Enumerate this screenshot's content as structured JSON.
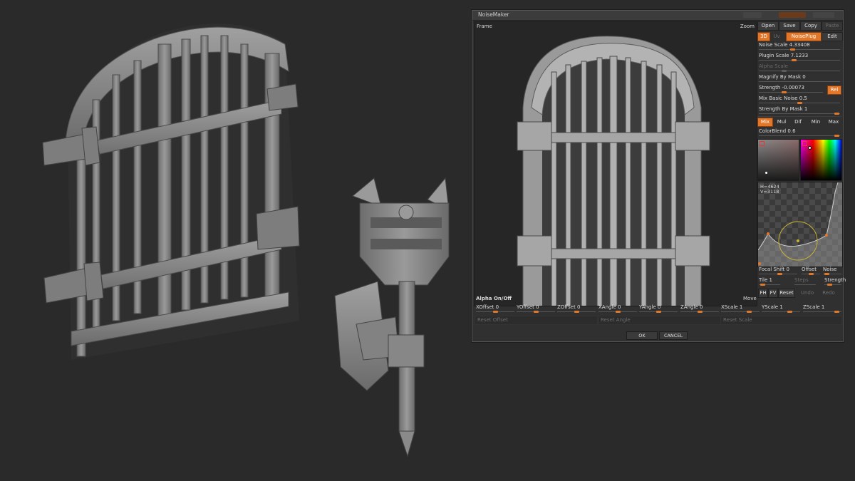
{
  "dialog": {
    "title": "NoiseMaker",
    "frame_label": "Frame",
    "zoom_label": "Zoom",
    "move_label": "Move",
    "alpha_toggle_label": "Alpha On/Off"
  },
  "file_buttons": {
    "open": "Open",
    "save": "Save",
    "copy": "Copy",
    "paste": "Paste"
  },
  "mode_buttons": {
    "three_d": "3D",
    "uv": "Uv",
    "noiseplug": "NoisePlug",
    "edit": "Edit"
  },
  "settings": {
    "noise_scale": "Noise Scale 4.33408",
    "plugin_scale": "Plugin Scale 7.1233",
    "alpha_scale": "Alpha Scale",
    "magnify_by_mask": "Magnify By Mask 0",
    "strength": "Strength -0.00073",
    "rel": "Rel",
    "mix_basic_noise": "Mix Basic Noise 0.5",
    "strength_by_mask": "Strength By Mask 1",
    "colorblend": "ColorBlend 0.6"
  },
  "blend_modes": [
    "Mix",
    "Mul",
    "Dif",
    "Min",
    "Max"
  ],
  "curve": {
    "readout_h": "H=4624",
    "readout_v": "V=3118",
    "focal_shift": "Focal Shift 0",
    "offset": "Offset",
    "noise": "Noise",
    "tile": "Tile 1",
    "steps": "Steps",
    "strength": "Strength"
  },
  "curve_buttons": {
    "fh": "FH",
    "fv": "FV",
    "reset": "Reset",
    "undo": "Undo",
    "redo": "Redo"
  },
  "transforms": {
    "xoffset": "XOffset 0",
    "yoffset": "YOffset 0",
    "zoffset": "ZOffset 0",
    "xangle": "XAngle 0",
    "yangle": "YAngle 0",
    "zangle": "ZAngle 0",
    "xscale": "XScale 1",
    "yscale": "YScale 1",
    "zscale": "ZScale 1"
  },
  "reset_buttons": {
    "offset": "Reset Offset",
    "angle": "Reset Angle",
    "scale": "Reset Scale"
  },
  "footer": {
    "ok": "OK",
    "cancel": "CANCEL"
  },
  "colors": {
    "accent": "#e2772a",
    "panel": "#303030",
    "viewport": "#2a2a2a",
    "clay": "#8c8c8c"
  }
}
